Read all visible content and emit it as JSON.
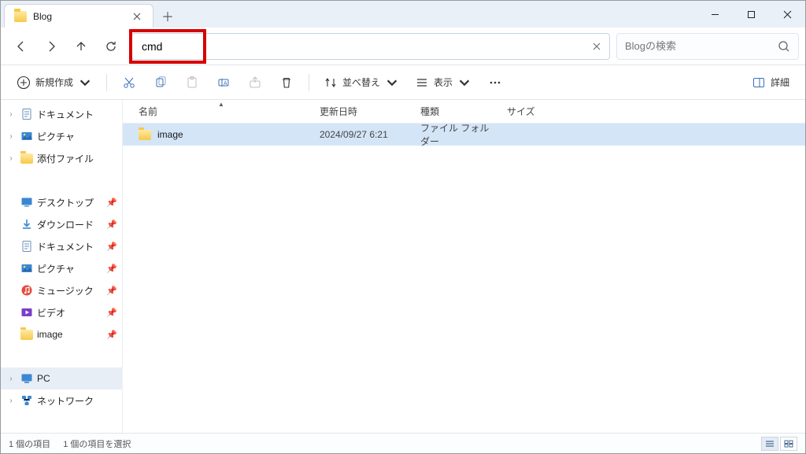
{
  "titlebar": {
    "tab_title": "Blog"
  },
  "address_bar": {
    "value": "cmd"
  },
  "search_bar": {
    "placeholder": "Blogの検索"
  },
  "toolbar": {
    "new_label": "新規作成",
    "sort_label": "並べ替え",
    "view_label": "表示",
    "details_label": "詳細"
  },
  "columns": {
    "name": "名前",
    "date": "更新日時",
    "type": "種類",
    "size": "サイズ"
  },
  "files": [
    {
      "name": "image",
      "date": "2024/09/27 6:21",
      "type": "ファイル フォルダー",
      "size": ""
    }
  ],
  "sidebar": {
    "top": [
      {
        "label": "ドキュメント",
        "icon": "doc"
      },
      {
        "label": "ピクチャ",
        "icon": "pic"
      },
      {
        "label": "添付ファイル",
        "icon": "folder"
      }
    ],
    "quick": [
      {
        "label": "デスクトップ",
        "icon": "desktop"
      },
      {
        "label": "ダウンロード",
        "icon": "download"
      },
      {
        "label": "ドキュメント",
        "icon": "doc"
      },
      {
        "label": "ピクチャ",
        "icon": "pic"
      },
      {
        "label": "ミュージック",
        "icon": "music"
      },
      {
        "label": "ビデオ",
        "icon": "video"
      },
      {
        "label": "image",
        "icon": "folder"
      }
    ],
    "bottom": [
      {
        "label": "PC",
        "icon": "pc"
      },
      {
        "label": "ネットワーク",
        "icon": "network"
      }
    ]
  },
  "statusbar": {
    "count": "1 個の項目",
    "selected": "1 個の項目を選択"
  }
}
